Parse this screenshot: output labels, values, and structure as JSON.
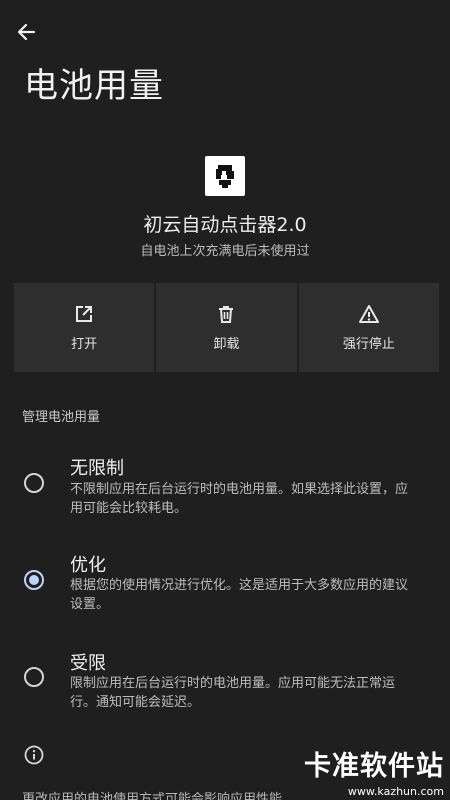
{
  "header": {
    "title": "电池用量"
  },
  "app": {
    "name": "初云自动点击器2.0",
    "subtitle": "自电池上次充满电后未使用过"
  },
  "actions": [
    {
      "label": "打开",
      "icon": "open-external-icon"
    },
    {
      "label": "卸载",
      "icon": "trash-icon"
    },
    {
      "label": "强行停止",
      "icon": "warning-icon"
    }
  ],
  "section": {
    "label": "管理电池用量"
  },
  "options": [
    {
      "title": "无限制",
      "desc": "不限制应用在后台运行时的电池用量。如果选择此设置，应用可能会比较耗电。",
      "selected": false
    },
    {
      "title": "优化",
      "desc": "根据您的使用情况进行优化。这是适用于大多数应用的建议设置。",
      "selected": true
    },
    {
      "title": "受限",
      "desc": "限制应用在后台运行时的电池用量。应用可能无法正常运行。通知可能会延迟。",
      "selected": false
    }
  ],
  "footer": {
    "note": "更改应用的电池使用方式可能会影响应用性能"
  },
  "watermark": {
    "text": "卡准软件站",
    "url": "www.kazhun.com"
  },
  "colors": {
    "background": "#1f1f1f",
    "card": "#2e2e2e",
    "accent": "#bcd4f6"
  }
}
